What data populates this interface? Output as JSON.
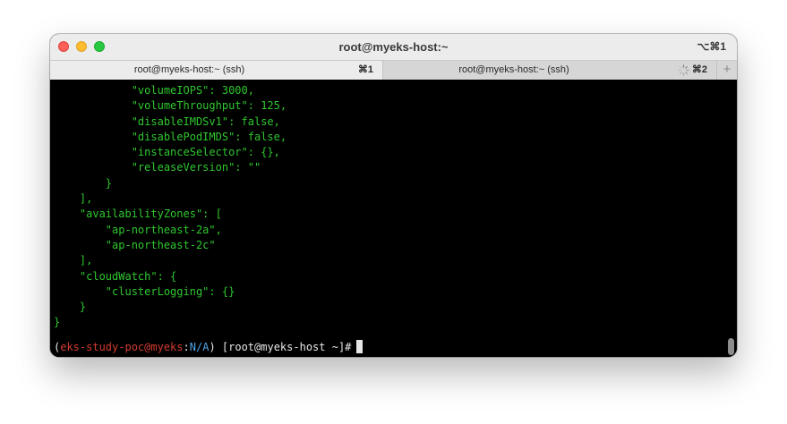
{
  "window": {
    "title": "root@myeks-host:~",
    "title_shortcut": "⌥⌘1"
  },
  "tabs": [
    {
      "label": "root@myeks-host:~ (ssh)",
      "shortcut": "⌘1",
      "active": true
    },
    {
      "label": "root@myeks-host:~ (ssh)",
      "shortcut": "⌘2",
      "active": false,
      "loading": true
    }
  ],
  "new_tab_label": "+",
  "terminal": {
    "lines": [
      "            \"volumeIOPS\": 3000,",
      "            \"volumeThroughput\": 125,",
      "            \"disableIMDSv1\": false,",
      "            \"disablePodIMDS\": false,",
      "            \"instanceSelector\": {},",
      "            \"releaseVersion\": \"\"",
      "        }",
      "    ],",
      "    \"availabilityZones\": [",
      "        \"ap-northeast-2a\",",
      "        \"ap-northeast-2c\"",
      "    ],",
      "    \"cloudWatch\": {",
      "        \"clusterLogging\": {}",
      "    }",
      "}"
    ],
    "prompt": {
      "open_paren": "(",
      "context": "eks-study-poc@myeks",
      "separator": ":",
      "namespace": "N/A",
      "close_paren": ")",
      "user_host": " [root@myeks-host ~]#"
    }
  },
  "colors": {
    "output_text": "#2fc72f",
    "prompt_context": "#d23a2f",
    "prompt_namespace": "#4fa3e3",
    "background": "#000000"
  }
}
